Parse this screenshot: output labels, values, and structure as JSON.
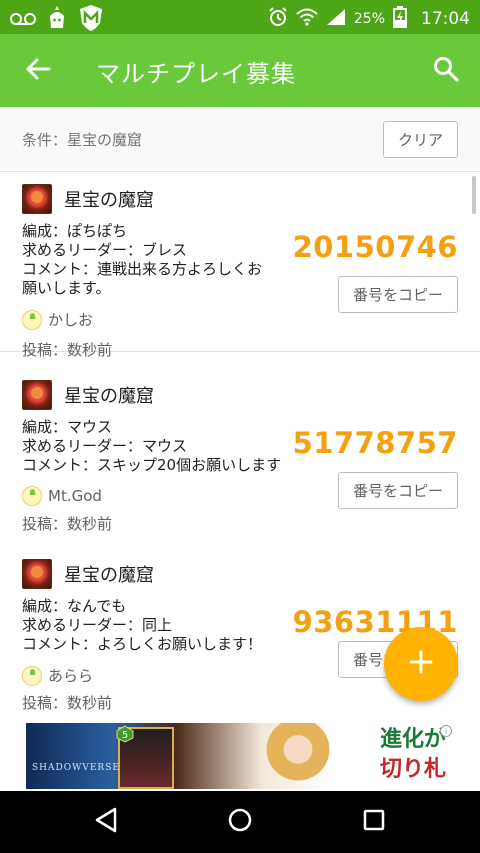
{
  "status_bar": {
    "battery_percent": "25%",
    "time": "17:04",
    "icons": [
      "voicemail-icon",
      "app-mascot-icon",
      "shield-m-icon",
      "alarm-icon",
      "wifi-icon",
      "signal-icon",
      "battery-charging-icon"
    ]
  },
  "app_bar": {
    "title": "マルチプレイ募集",
    "back_icon": "arrow-back-icon",
    "search_icon": "search-icon"
  },
  "filter": {
    "condition_text": "条件：星宝の魔窟",
    "clear_label": "クリア"
  },
  "colors": {
    "status_bar": "#4da616",
    "app_bar": "#6ac93a",
    "room_number": "#f5a010",
    "fab": "#ffb300"
  },
  "posts": [
    {
      "dungeon": "星宝の魔窟",
      "formation": "編成：ぽちぽち",
      "leader": "求めるリーダー：ブレス",
      "comment_line1": "コメント：連戦出来る方よろしくお",
      "comment_line2": "願いします。",
      "room_number": "20150746",
      "copy_label": "番号をコピー",
      "user": "かしお",
      "posted": "投稿：数秒前"
    },
    {
      "dungeon": "星宝の魔窟",
      "formation": "編成：マウス",
      "leader": "求めるリーダー：マウス",
      "comment_line1": "コメント：スキップ20個お願いします",
      "comment_line2": "",
      "room_number": "51778757",
      "copy_label": "番号をコピー",
      "user": "Mt.God",
      "posted": "投稿：数秒前"
    },
    {
      "dungeon": "星宝の魔窟",
      "formation": "編成：なんでも",
      "leader": "求めるリーダー：同上",
      "comment_line1": "コメント：よろしくお願いします！",
      "comment_line2": "",
      "room_number": "93631111",
      "copy_label": "番号をコピー",
      "user": "あらら",
      "posted": "投稿：数秒前"
    }
  ],
  "fab": {
    "icon": "plus-icon"
  },
  "ad": {
    "logo_text": "SHADOWVERSE",
    "card_cost": "5",
    "headline_1": "進化が",
    "headline_2": "切り札",
    "info_mark": "i"
  },
  "nav_bar": {
    "icons": [
      "nav-back-icon",
      "nav-home-icon",
      "nav-recents-icon"
    ]
  }
}
